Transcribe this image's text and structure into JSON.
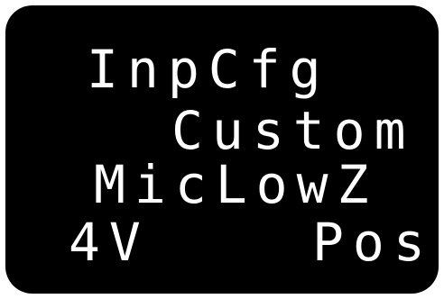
{
  "display": {
    "line1": "InpCfg",
    "line2": "Custom",
    "line3": "MicLowZ",
    "line4_left": "4V",
    "line4_right": "Pos"
  }
}
